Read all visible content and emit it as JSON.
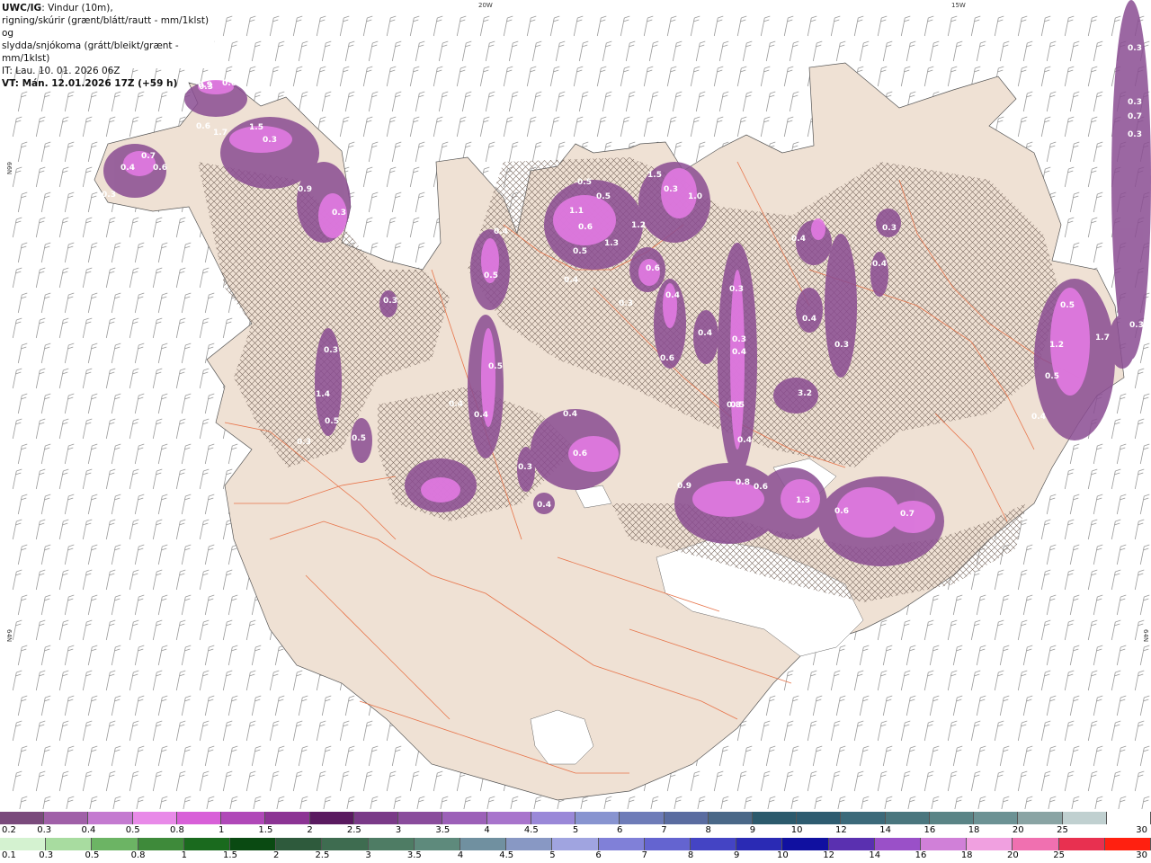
{
  "title": {
    "model": "UWC/IG",
    "line1_rest": ": Vindur (10m),",
    "line2": "rigning/skúrir (grænt/blátt/rautt - mm/1klst) og",
    "line3": "slydda/snjókoma (grátt/bleikt/grænt - mm/1klst)",
    "issue_time": "IT: Lau. 10. 01. 2026 06Z",
    "valid_time": "VT: Mán. 12.01.2026 17Z (+59 h)"
  },
  "axis_labels": {
    "top_20w": "20W",
    "top_15w": "15W",
    "left_66n": "66N",
    "left_64n": "64N",
    "right_64n": "64N"
  },
  "snow_values": [
    "0.4",
    "0.7",
    "0.6",
    "0.3",
    "0.3",
    "0.6",
    "0.6",
    "1.7",
    "1.5",
    "0.3",
    "0.9",
    "0.3",
    "0.9",
    "0.5",
    "0.5",
    "1.1",
    "0.6",
    "1.3",
    "1.2",
    "1.5",
    "0.3",
    "1.0",
    "0.5",
    "0.6",
    "0.5",
    "0.4",
    "0.4",
    "0.3",
    "0.3",
    "1.4",
    "0.5",
    "0.4",
    "0.3",
    "0.3",
    "0.4",
    "0.4",
    "0.6",
    "0.4",
    "0.4",
    "0.3",
    "0.4",
    "0.5",
    "0.4",
    "0.6",
    "0.4",
    "0.5",
    "0.3",
    "0.5",
    "0.8",
    "0.3",
    "0.4",
    "0.9",
    "0.8",
    "0.6",
    "1.3",
    "0.6",
    "0.7",
    "0.4",
    "0.3",
    "0.3",
    "0.4",
    "3.2",
    "0.5",
    "1.7",
    "1.2",
    "0.5",
    "0.4",
    "0.3",
    "0.3",
    "0.3",
    "0.3",
    "0.7"
  ],
  "legend": {
    "snow_labels": [
      "0.2",
      "0.3",
      "0.4",
      "0.5",
      "0.8",
      "1",
      "1.5",
      "2",
      "2.5",
      "3",
      "3.5",
      "4",
      "4.5",
      "5",
      "6",
      "7",
      "8",
      "9",
      "10",
      "12",
      "14",
      "16",
      "18",
      "20",
      "25",
      "30"
    ],
    "snow_colors": [
      "#7a4a7c",
      "#a060a8",
      "#c47ad0",
      "#e88ae8",
      "#d860d8",
      "#b048b8",
      "#8c3494",
      "#5a1a60",
      "#7a3a88",
      "#8a4c9c",
      "#9c60b8",
      "#a874cc",
      "#9a88d8",
      "#8894d0",
      "#6e7cb8",
      "#5a6ca0",
      "#4a6888",
      "#2c5a6c",
      "#2e5c70",
      "#3c6a7a",
      "#4a767e",
      "#5a8486",
      "#6c9294",
      "#8aa4a4",
      "#c0d0d0",
      "#ffffff"
    ],
    "rain_labels": [
      "0.1",
      "0.3",
      "0.5",
      "0.8",
      "1",
      "1.5",
      "2",
      "2.5",
      "3",
      "3.5",
      "4",
      "4.5",
      "5",
      "6",
      "7",
      "8",
      "9",
      "10",
      "12",
      "14",
      "16",
      "18",
      "20",
      "25",
      "30"
    ],
    "rain_colors": [
      "#d4f2d0",
      "#a8dca0",
      "#6cb464",
      "#3e8a3a",
      "#1a6a1e",
      "#0a4a12",
      "#2e5a3c",
      "#3e6c50",
      "#4e7c64",
      "#5e8a7c",
      "#7090a0",
      "#8898c4",
      "#a0a4e0",
      "#8080d8",
      "#6464d0",
      "#4444c4",
      "#2a2ab4",
      "#1010a0",
      "#5a30b0",
      "#9a50c8",
      "#d080d8",
      "#f0a0e0",
      "#f070b0",
      "#e83050",
      "#ff2010"
    ]
  }
}
